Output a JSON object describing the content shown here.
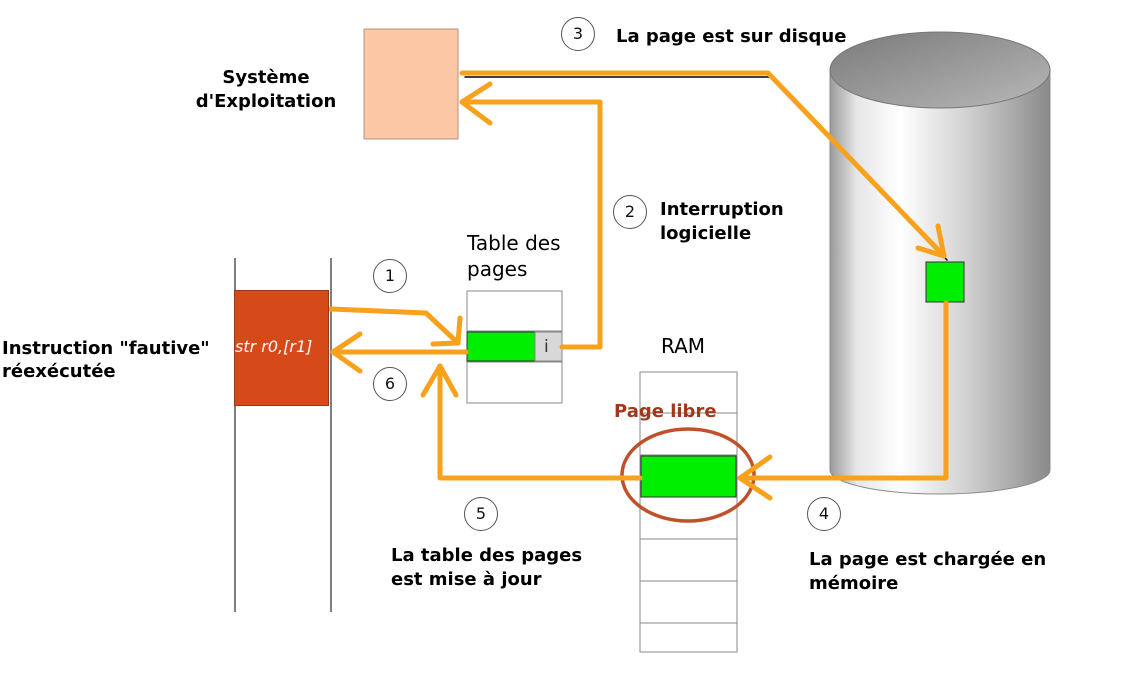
{
  "labels": {
    "os": "Système\nd'Exploitation",
    "step3": "La page est sur disque",
    "step2": "Interruption\nlogicielle",
    "page_table": "Table des\npages",
    "invalid_bit": "i",
    "ram": "RAM",
    "free_page": "Page libre",
    "instruction_line1": "Instruction \"fautive\"",
    "instruction_line2": "réexécutée",
    "instruction_code": "str r0,[r1]",
    "step5": "La table des pages\nest mise à jour",
    "step4": "La page est chargée en\nmémoire"
  },
  "steps": [
    "1",
    "2",
    "3",
    "4",
    "5",
    "6"
  ],
  "colors": {
    "arrow": "#f7a11c",
    "os_box": "#fcc7a5",
    "instruction_box": "#d64a1a",
    "page_green": "#00ee00",
    "free_page_text": "#a0391b",
    "free_page_ring": "#c0502a"
  }
}
